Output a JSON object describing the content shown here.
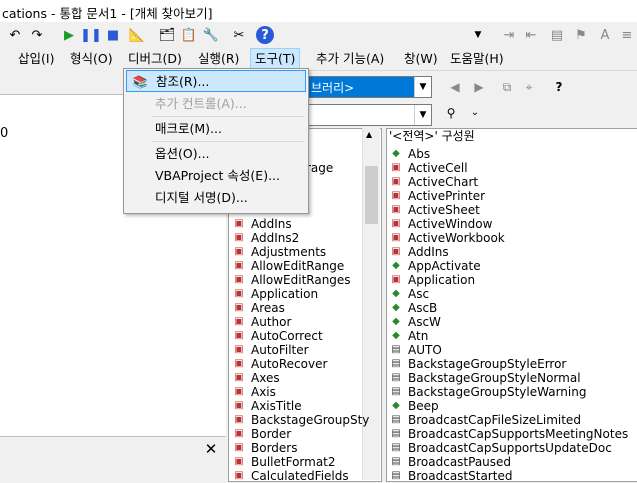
{
  "title_bar": {
    "text": "cations - 통합 문서1 - [개체 찾아보기]"
  },
  "menu": {
    "items": [
      {
        "label": "삽입(I)"
      },
      {
        "label": "형식(O)"
      },
      {
        "label": "디버그(D)"
      },
      {
        "label": "실행(R)"
      },
      {
        "label": "도구(T)"
      },
      {
        "label": "추가 기능(A)"
      },
      {
        "label": "창(W)"
      },
      {
        "label": "도움말(H)"
      }
    ]
  },
  "tools_menu": {
    "items": [
      {
        "label": "참조(R)...",
        "state": "highlighted",
        "icon": "references-icon"
      },
      {
        "label": "추가 컨트롤(A)...",
        "state": "disabled"
      },
      {
        "label": "매크로(M)...",
        "state": "normal"
      },
      {
        "label": "옵션(O)...",
        "state": "normal"
      },
      {
        "label": "VBAProject 속성(E)...",
        "state": "normal"
      },
      {
        "label": "디지털 서명(D)...",
        "state": "normal"
      }
    ]
  },
  "object_browser": {
    "library_selector": "브러리>",
    "classes_partial_label": "rage",
    "classes": [
      "AddIns",
      "AddIns2",
      "Adjustments",
      "AllowEditRange",
      "AllowEditRanges",
      "Application",
      "Areas",
      "Author",
      "AutoCorrect",
      "AutoFilter",
      "AutoRecover",
      "Axes",
      "Axis",
      "AxisTitle",
      "BackstageGroupSty",
      "Border",
      "Borders",
      "BulletFormat2",
      "CalculatedFields"
    ],
    "members_header": "'<전역>' 구성원",
    "members": [
      {
        "name": "Abs",
        "kind": "function"
      },
      {
        "name": "ActiveCell",
        "kind": "property"
      },
      {
        "name": "ActiveChart",
        "kind": "property"
      },
      {
        "name": "ActivePrinter",
        "kind": "property"
      },
      {
        "name": "ActiveSheet",
        "kind": "property"
      },
      {
        "name": "ActiveWindow",
        "kind": "property"
      },
      {
        "name": "ActiveWorkbook",
        "kind": "property"
      },
      {
        "name": "AddIns",
        "kind": "property"
      },
      {
        "name": "AppActivate",
        "kind": "function"
      },
      {
        "name": "Application",
        "kind": "property"
      },
      {
        "name": "Asc",
        "kind": "function"
      },
      {
        "name": "AscB",
        "kind": "function"
      },
      {
        "name": "AscW",
        "kind": "function"
      },
      {
        "name": "Atn",
        "kind": "function"
      },
      {
        "name": "AUTO",
        "kind": "constant"
      },
      {
        "name": "BackstageGroupStyleError",
        "kind": "constant"
      },
      {
        "name": "BackstageGroupStyleNormal",
        "kind": "constant"
      },
      {
        "name": "BackstageGroupStyleWarning",
        "kind": "constant"
      },
      {
        "name": "Beep",
        "kind": "function"
      },
      {
        "name": "BroadcastCapFileSizeLimited",
        "kind": "constant"
      },
      {
        "name": "BroadcastCapSupportsMeetingNotes",
        "kind": "constant"
      },
      {
        "name": "BroadcastCapSupportsUpdateDoc",
        "kind": "constant"
      },
      {
        "name": "BroadcastPaused",
        "kind": "constant"
      },
      {
        "name": "BroadcastStarted",
        "kind": "constant"
      }
    ]
  },
  "left_pane": {
    "cursor_text": "0"
  },
  "colors": {
    "accent": "#0078d7",
    "highlight": "#cce8ff"
  }
}
